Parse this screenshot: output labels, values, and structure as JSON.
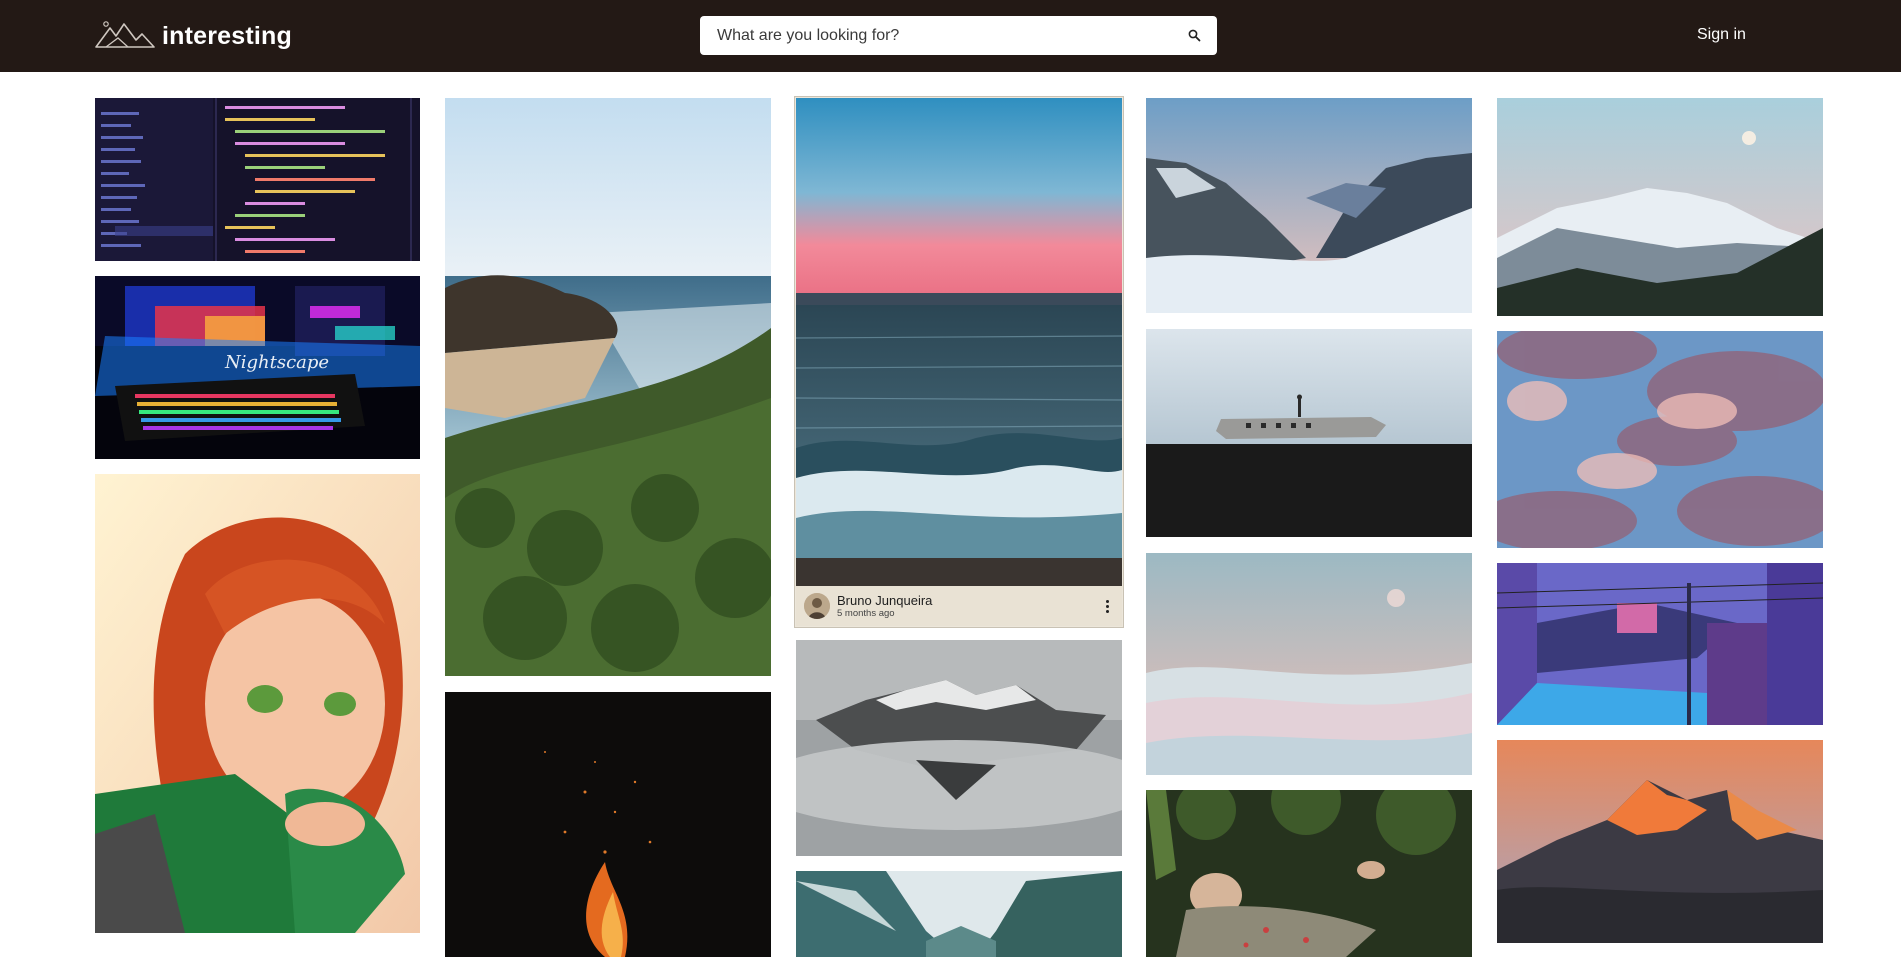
{
  "brand": {
    "name": "interesting"
  },
  "search": {
    "placeholder": "What are you looking for?"
  },
  "nav": {
    "signin_label": "Sign in"
  },
  "featured_card": {
    "author": "Bruno Junqueira",
    "time": "5 months ago"
  },
  "colors": {
    "topbar": "#231915",
    "card_footer": "#e9e2d4"
  }
}
